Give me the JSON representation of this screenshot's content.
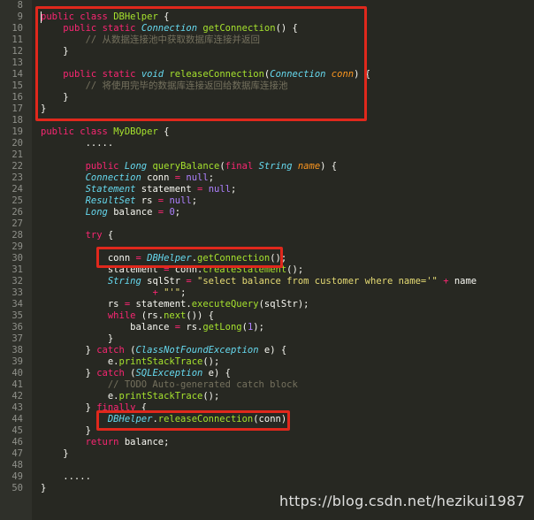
{
  "editor": {
    "lines": [
      {
        "n": "8",
        "t": []
      },
      {
        "n": "9",
        "t": [
          [
            "kw",
            "public"
          ],
          [
            "pl",
            " "
          ],
          [
            "kw",
            "class"
          ],
          [
            "pl",
            " "
          ],
          [
            "cls",
            "DBHelper"
          ],
          [
            "pl",
            " {"
          ]
        ]
      },
      {
        "n": "10",
        "t": [
          [
            "pl",
            "    "
          ],
          [
            "kw",
            "public"
          ],
          [
            "pl",
            " "
          ],
          [
            "kw",
            "static"
          ],
          [
            "pl",
            " "
          ],
          [
            "ty",
            "Connection"
          ],
          [
            "pl",
            " "
          ],
          [
            "fn",
            "getConnection"
          ],
          [
            "pl",
            "() {"
          ]
        ]
      },
      {
        "n": "11",
        "t": [
          [
            "pl",
            "        "
          ],
          [
            "cm",
            "// 从数据连接池中获取数据库连接并返回"
          ]
        ]
      },
      {
        "n": "12",
        "t": [
          [
            "pl",
            "    }"
          ]
        ]
      },
      {
        "n": "13",
        "t": []
      },
      {
        "n": "14",
        "t": [
          [
            "pl",
            "    "
          ],
          [
            "kw",
            "public"
          ],
          [
            "pl",
            " "
          ],
          [
            "kw",
            "static"
          ],
          [
            "pl",
            " "
          ],
          [
            "ty",
            "void"
          ],
          [
            "pl",
            " "
          ],
          [
            "fn",
            "releaseConnection"
          ],
          [
            "pl",
            "("
          ],
          [
            "ty",
            "Connection"
          ],
          [
            "pl",
            " "
          ],
          [
            "prm",
            "conn"
          ],
          [
            "pl",
            ") {"
          ]
        ]
      },
      {
        "n": "15",
        "t": [
          [
            "pl",
            "        "
          ],
          [
            "cm",
            "// 将使用完毕的数据库连接返回给数据库连接池"
          ]
        ]
      },
      {
        "n": "16",
        "t": [
          [
            "pl",
            "    }"
          ]
        ]
      },
      {
        "n": "17",
        "t": [
          [
            "pl",
            "}"
          ]
        ]
      },
      {
        "n": "18",
        "t": []
      },
      {
        "n": "19",
        "t": [
          [
            "kw",
            "public"
          ],
          [
            "pl",
            " "
          ],
          [
            "kw",
            "class"
          ],
          [
            "pl",
            " "
          ],
          [
            "cls",
            "MyDBOper"
          ],
          [
            "pl",
            " {"
          ]
        ]
      },
      {
        "n": "20",
        "t": [
          [
            "pl",
            "        ....."
          ]
        ]
      },
      {
        "n": "21",
        "t": []
      },
      {
        "n": "22",
        "t": [
          [
            "pl",
            "        "
          ],
          [
            "kw",
            "public"
          ],
          [
            "pl",
            " "
          ],
          [
            "ty",
            "Long"
          ],
          [
            "pl",
            " "
          ],
          [
            "fn",
            "queryBalance"
          ],
          [
            "pl",
            "("
          ],
          [
            "kw",
            "final"
          ],
          [
            "pl",
            " "
          ],
          [
            "ty",
            "String"
          ],
          [
            "pl",
            " "
          ],
          [
            "prm",
            "name"
          ],
          [
            "pl",
            ") {"
          ]
        ]
      },
      {
        "n": "23",
        "t": [
          [
            "pl",
            "        "
          ],
          [
            "ty",
            "Connection"
          ],
          [
            "pl",
            " conn "
          ],
          [
            "kw",
            "="
          ],
          [
            "pl",
            " "
          ],
          [
            "num",
            "null"
          ],
          [
            "pl",
            ";"
          ]
        ]
      },
      {
        "n": "24",
        "t": [
          [
            "pl",
            "        "
          ],
          [
            "ty",
            "Statement"
          ],
          [
            "pl",
            " statement "
          ],
          [
            "kw",
            "="
          ],
          [
            "pl",
            " "
          ],
          [
            "num",
            "null"
          ],
          [
            "pl",
            ";"
          ]
        ]
      },
      {
        "n": "25",
        "t": [
          [
            "pl",
            "        "
          ],
          [
            "ty",
            "ResultSet"
          ],
          [
            "pl",
            " rs "
          ],
          [
            "kw",
            "="
          ],
          [
            "pl",
            " "
          ],
          [
            "num",
            "null"
          ],
          [
            "pl",
            ";"
          ]
        ]
      },
      {
        "n": "26",
        "t": [
          [
            "pl",
            "        "
          ],
          [
            "ty",
            "Long"
          ],
          [
            "pl",
            " balance "
          ],
          [
            "kw",
            "="
          ],
          [
            "pl",
            " "
          ],
          [
            "num",
            "0"
          ],
          [
            "pl",
            ";"
          ]
        ]
      },
      {
        "n": "27",
        "t": []
      },
      {
        "n": "28",
        "t": [
          [
            "pl",
            "        "
          ],
          [
            "kw",
            "try"
          ],
          [
            "pl",
            " {"
          ]
        ]
      },
      {
        "n": "29",
        "t": []
      },
      {
        "n": "30",
        "t": [
          [
            "pl",
            "            conn "
          ],
          [
            "kw",
            "="
          ],
          [
            "pl",
            " "
          ],
          [
            "ty",
            "DBHelper"
          ],
          [
            "pl",
            "."
          ],
          [
            "fn",
            "getConnection"
          ],
          [
            "pl",
            "();"
          ]
        ]
      },
      {
        "n": "31",
        "t": [
          [
            "pl",
            "            statement "
          ],
          [
            "kw",
            "="
          ],
          [
            "pl",
            " conn."
          ],
          [
            "fn",
            "createStatement"
          ],
          [
            "pl",
            "();"
          ]
        ]
      },
      {
        "n": "32",
        "t": [
          [
            "pl",
            "            "
          ],
          [
            "ty",
            "String"
          ],
          [
            "pl",
            " sqlStr "
          ],
          [
            "kw",
            "="
          ],
          [
            "pl",
            " "
          ],
          [
            "str",
            "\"select balance from customer where name='\""
          ],
          [
            "pl",
            " "
          ],
          [
            "kw",
            "+"
          ],
          [
            "pl",
            " name"
          ]
        ]
      },
      {
        "n": "33",
        "t": [
          [
            "pl",
            "                    "
          ],
          [
            "kw",
            "+"
          ],
          [
            "pl",
            " "
          ],
          [
            "str",
            "\"'\""
          ],
          [
            "pl",
            ";"
          ]
        ]
      },
      {
        "n": "34",
        "t": [
          [
            "pl",
            "            rs "
          ],
          [
            "kw",
            "="
          ],
          [
            "pl",
            " statement."
          ],
          [
            "fn",
            "executeQuery"
          ],
          [
            "pl",
            "(sqlStr);"
          ]
        ]
      },
      {
        "n": "35",
        "t": [
          [
            "pl",
            "            "
          ],
          [
            "kw",
            "while"
          ],
          [
            "pl",
            " (rs."
          ],
          [
            "fn",
            "next"
          ],
          [
            "pl",
            "()) {"
          ]
        ]
      },
      {
        "n": "36",
        "t": [
          [
            "pl",
            "                balance "
          ],
          [
            "kw",
            "="
          ],
          [
            "pl",
            " rs."
          ],
          [
            "fn",
            "getLong"
          ],
          [
            "pl",
            "("
          ],
          [
            "num",
            "1"
          ],
          [
            "pl",
            ");"
          ]
        ]
      },
      {
        "n": "37",
        "t": [
          [
            "pl",
            "            }"
          ]
        ]
      },
      {
        "n": "38",
        "t": [
          [
            "pl",
            "        } "
          ],
          [
            "kw",
            "catch"
          ],
          [
            "pl",
            " ("
          ],
          [
            "ty",
            "ClassNotFoundException"
          ],
          [
            "pl",
            " e) {"
          ]
        ]
      },
      {
        "n": "39",
        "t": [
          [
            "pl",
            "            e."
          ],
          [
            "fn",
            "printStackTrace"
          ],
          [
            "pl",
            "();"
          ]
        ]
      },
      {
        "n": "40",
        "t": [
          [
            "pl",
            "        } "
          ],
          [
            "kw",
            "catch"
          ],
          [
            "pl",
            " ("
          ],
          [
            "ty",
            "SQLException"
          ],
          [
            "pl",
            " e) {"
          ]
        ]
      },
      {
        "n": "41",
        "t": [
          [
            "pl",
            "            "
          ],
          [
            "cm",
            "// TODO Auto-generated catch block"
          ]
        ]
      },
      {
        "n": "42",
        "t": [
          [
            "pl",
            "            e."
          ],
          [
            "fn",
            "printStackTrace"
          ],
          [
            "pl",
            "();"
          ]
        ]
      },
      {
        "n": "43",
        "t": [
          [
            "pl",
            "        } "
          ],
          [
            "kw",
            "finally"
          ],
          [
            "pl",
            " {"
          ]
        ]
      },
      {
        "n": "44",
        "t": [
          [
            "pl",
            "            "
          ],
          [
            "ty",
            "DBHelper"
          ],
          [
            "pl",
            "."
          ],
          [
            "fn",
            "releaseConnection"
          ],
          [
            "pl",
            "(conn);"
          ]
        ]
      },
      {
        "n": "45",
        "t": [
          [
            "pl",
            "        }"
          ]
        ]
      },
      {
        "n": "46",
        "t": [
          [
            "pl",
            "        "
          ],
          [
            "kw",
            "return"
          ],
          [
            "pl",
            " balance;"
          ]
        ]
      },
      {
        "n": "47",
        "t": [
          [
            "pl",
            "    }"
          ]
        ]
      },
      {
        "n": "48",
        "t": []
      },
      {
        "n": "49",
        "t": [
          [
            "pl",
            "    ....."
          ]
        ]
      },
      {
        "n": "50",
        "t": [
          [
            "pl",
            "}"
          ]
        ]
      }
    ]
  },
  "colors": {
    "background": "#272822",
    "highlight_border": "#e0281c",
    "keyword": "#f92672",
    "type": "#66d9ef",
    "function": "#a6e22e",
    "comment": "#75715e",
    "string": "#e6db74",
    "number": "#ae81ff"
  },
  "watermark": "https://blog.csdn.net/hezikui1987"
}
